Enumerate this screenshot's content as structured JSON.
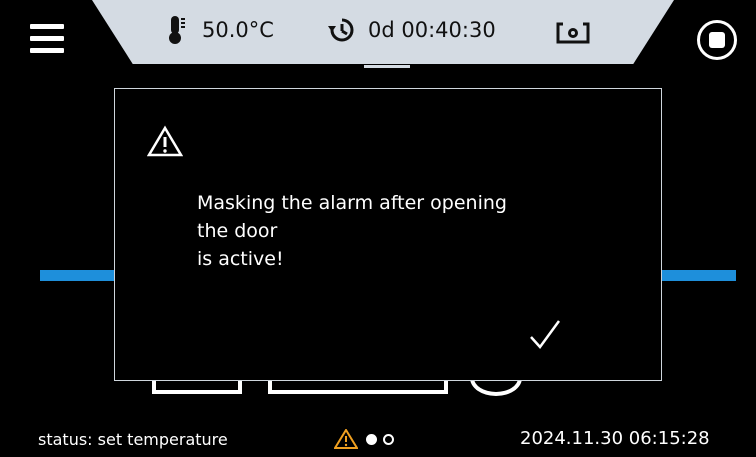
{
  "header": {
    "temperature": "50.0°C",
    "timer": "0d 00:40:30",
    "thermometer_icon": "thermometer-icon",
    "timer_icon": "clock-rewind-icon",
    "camera_icon": "camera-settings-icon"
  },
  "dialog": {
    "message": "Masking the alarm after opening\nthe door\nis active!",
    "warning_icon": "warning-triangle-icon",
    "confirm_icon": "checkmark-icon"
  },
  "footer": {
    "status": "status: set temperature",
    "datetime": "2024.11.30  06:15:28",
    "page_indicator": {
      "current": 1,
      "total": 2
    }
  },
  "colors": {
    "background": "#000000",
    "header_bar": "#d4dbe3",
    "accent_blue": "#1e8fdb",
    "warning_orange": "#f0a020"
  }
}
